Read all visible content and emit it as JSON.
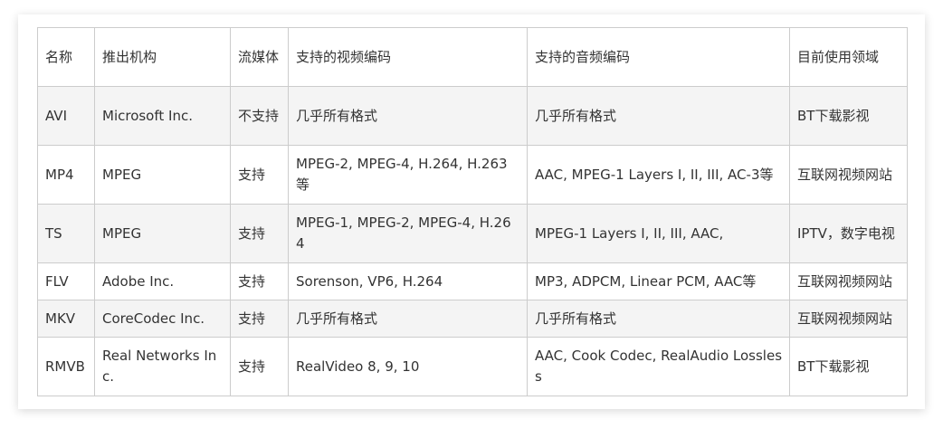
{
  "table": {
    "headers": [
      "名称",
      "推出机构",
      "流媒体",
      "支持的视频编码",
      "支持的音频编码",
      "目前使用领域"
    ],
    "rows": [
      [
        "AVI",
        "Microsoft Inc.",
        "不支持",
        "几乎所有格式",
        "几乎所有格式",
        "BT下载影视"
      ],
      [
        "MP4",
        "MPEG",
        "支持",
        "MPEG-2, MPEG-4, H.264, H.263等",
        "AAC, MPEG-1 Layers I, II, III, AC-3等",
        "互联网视频网站"
      ],
      [
        "TS",
        "MPEG",
        "支持",
        "MPEG-1, MPEG-2, MPEG-4, H.264",
        "MPEG-1 Layers I, II, III, AAC,",
        "IPTV，数字电视"
      ],
      [
        "FLV",
        "Adobe Inc.",
        "支持",
        "Sorenson, VP6, H.264",
        "MP3, ADPCM, Linear PCM, AAC等",
        "互联网视频网站"
      ],
      [
        "MKV",
        "CoreCodec Inc.",
        "支持",
        "几乎所有格式",
        "几乎所有格式",
        "互联网视频网站"
      ],
      [
        "RMVB",
        "Real Networks Inc.",
        "支持",
        "RealVideo 8, 9, 10",
        "AAC, Cook Codec, RealAudio Lossless",
        "BT下载影视"
      ]
    ]
  }
}
